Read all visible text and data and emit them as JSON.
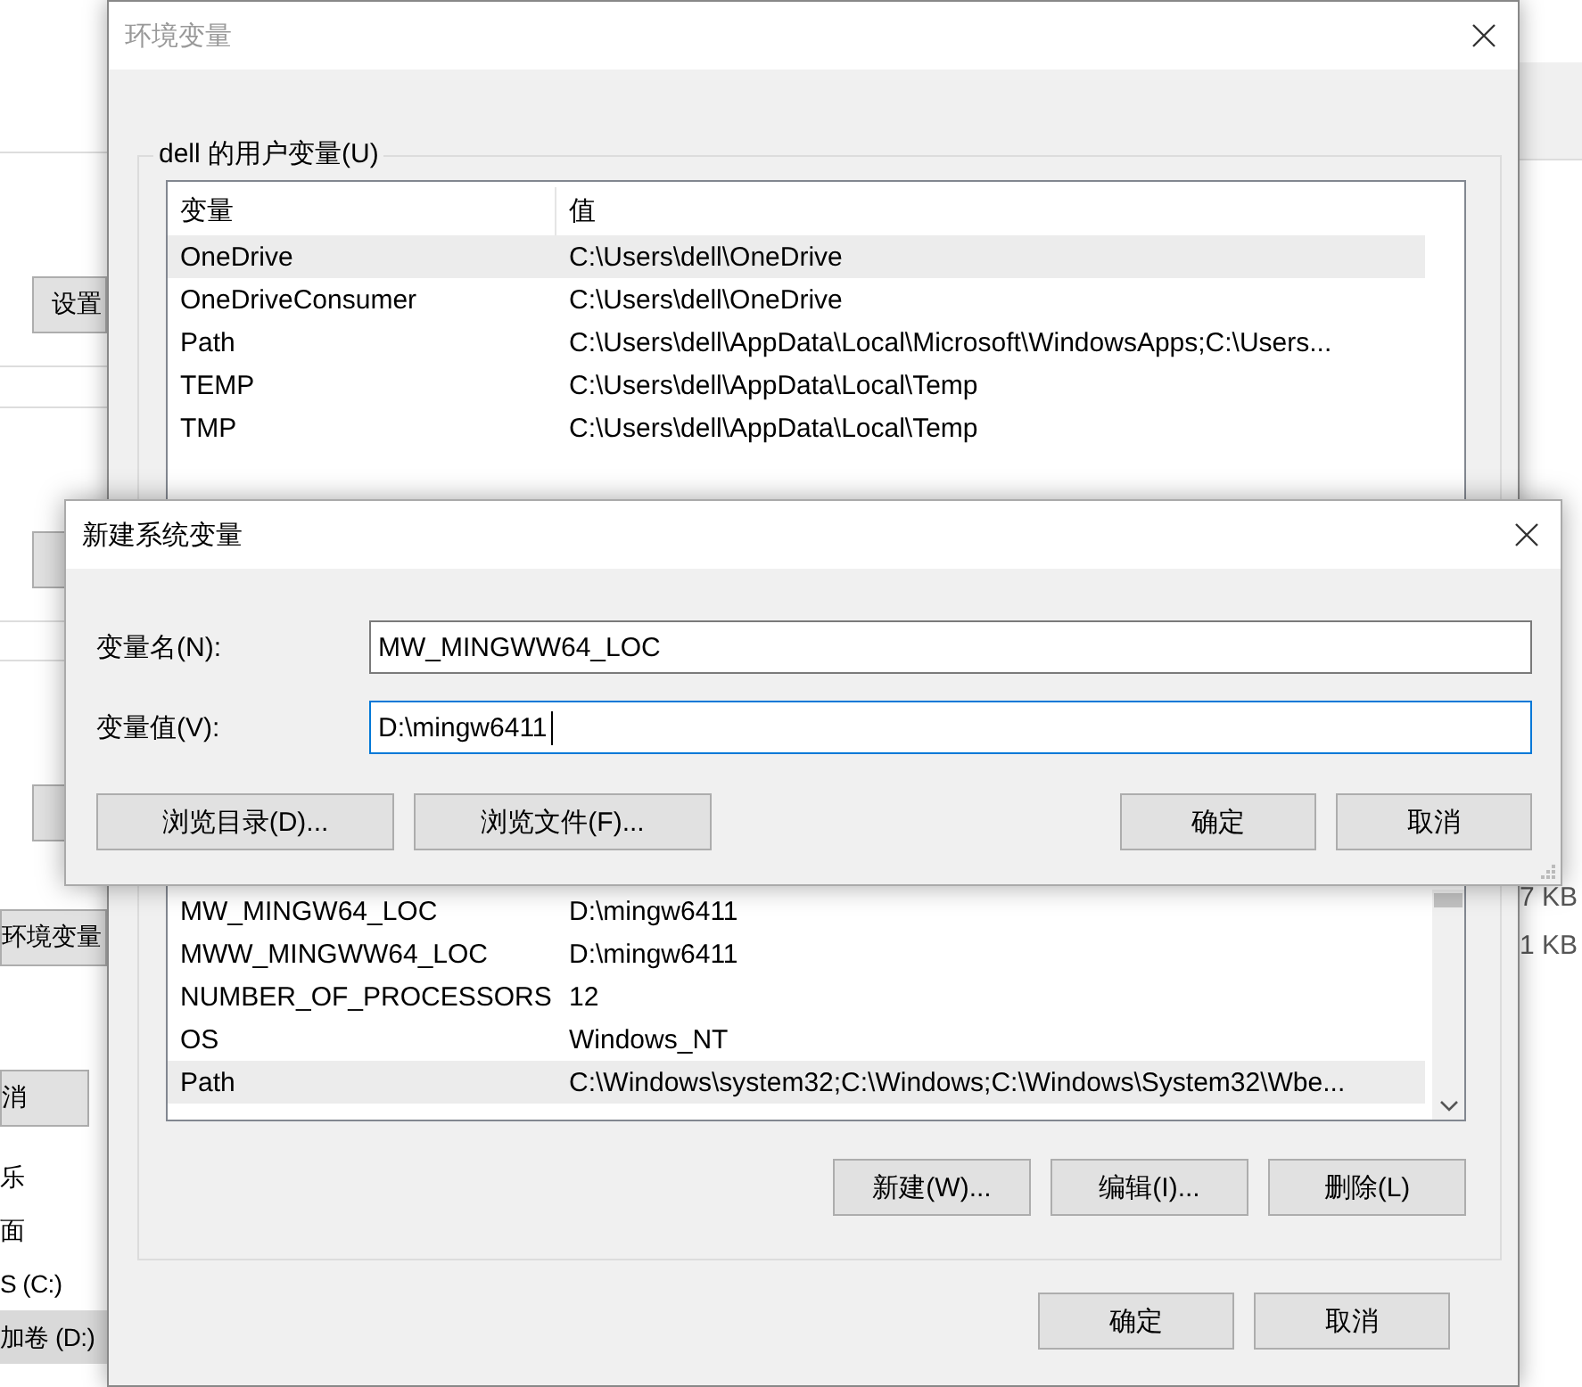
{
  "background_window": {
    "buttons": [
      {
        "label": "设置"
      },
      {
        "label": "环境变量"
      },
      {
        "label": "消"
      }
    ],
    "drives": [
      {
        "label": "乐",
        "selected": false
      },
      {
        "label": "面",
        "selected": false
      },
      {
        "label": "S (C:)",
        "selected": false
      },
      {
        "label": "加卷 (D:)",
        "selected": true
      }
    ],
    "sizes": [
      "7 KB",
      "1 KB"
    ]
  },
  "env_window": {
    "title": "环境变量",
    "user_group": {
      "title": "dell 的用户变量(U)",
      "columns": [
        "变量",
        "值"
      ],
      "rows": [
        {
          "name": "OneDrive",
          "value": "C:\\Users\\dell\\OneDrive",
          "selected": true
        },
        {
          "name": "OneDriveConsumer",
          "value": "C:\\Users\\dell\\OneDrive",
          "selected": false
        },
        {
          "name": "Path",
          "value": "C:\\Users\\dell\\AppData\\Local\\Microsoft\\WindowsApps;C:\\Users...",
          "selected": false
        },
        {
          "name": "TEMP",
          "value": "C:\\Users\\dell\\AppData\\Local\\Temp",
          "selected": false
        },
        {
          "name": "TMP",
          "value": "C:\\Users\\dell\\AppData\\Local\\Temp",
          "selected": false
        }
      ]
    },
    "system_group": {
      "rows": [
        {
          "name": "MW_MINGW64_LOC",
          "value": "D:\\mingw6411",
          "selected": false
        },
        {
          "name": "MWW_MINGWW64_LOC",
          "value": "D:\\mingw6411",
          "selected": false
        },
        {
          "name": "NUMBER_OF_PROCESSORS",
          "value": "12",
          "selected": false
        },
        {
          "name": "OS",
          "value": "Windows_NT",
          "selected": false
        },
        {
          "name": "Path",
          "value": "C:\\Windows\\system32;C:\\Windows;C:\\Windows\\System32\\Wbe...",
          "selected": true
        }
      ],
      "buttons": [
        "新建(W)...",
        "编辑(I)...",
        "删除(L)"
      ]
    },
    "buttons": [
      "确定",
      "取消"
    ]
  },
  "dialog": {
    "title": "新建系统变量",
    "fields": [
      {
        "label": "变量名(N):",
        "value": "MW_MINGWW64_LOC",
        "focused": false
      },
      {
        "label": "变量值(V):",
        "value": "D:\\mingw6411",
        "focused": true
      }
    ],
    "left_buttons": [
      "浏览目录(D)...",
      "浏览文件(F)..."
    ],
    "right_buttons": [
      "确定",
      "取消"
    ]
  }
}
